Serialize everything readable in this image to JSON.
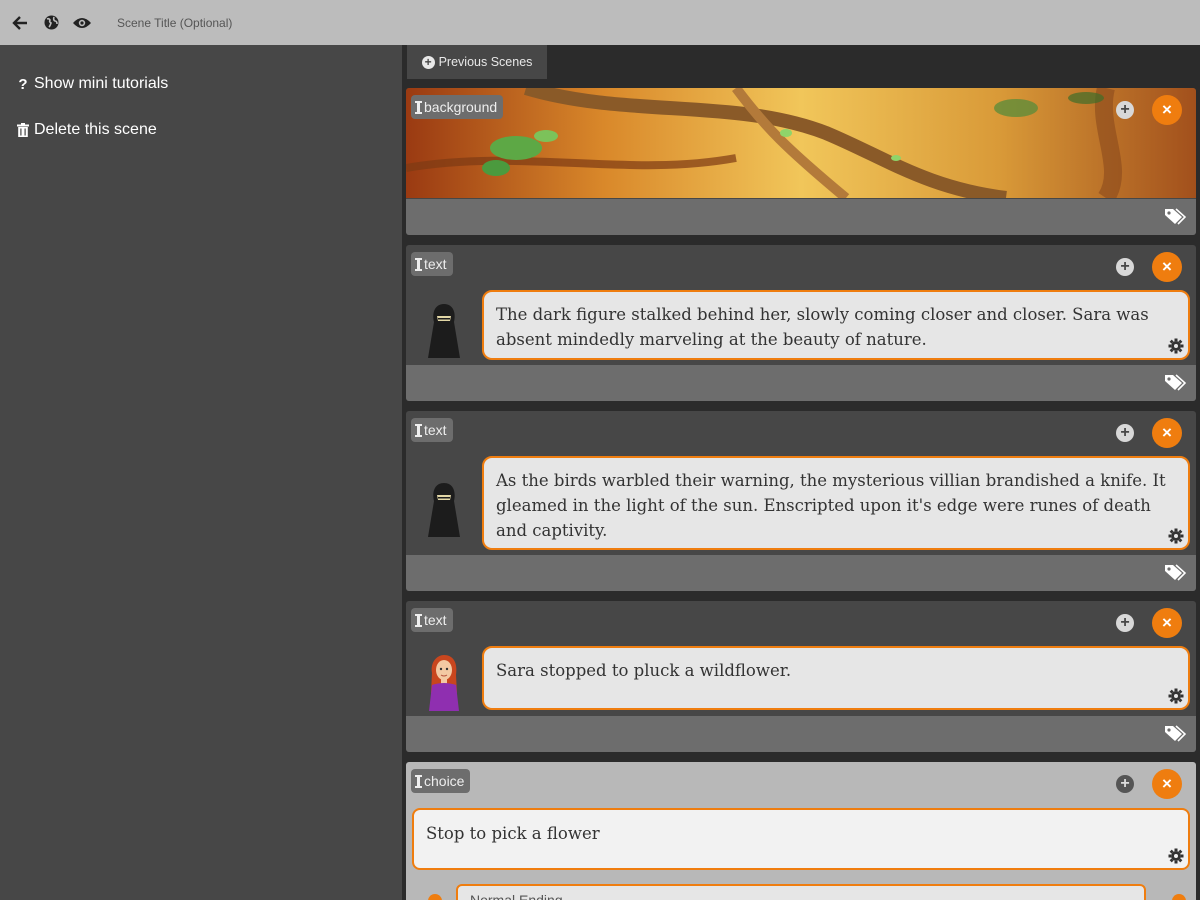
{
  "topbar": {
    "back_icon": "arrow-left-icon",
    "globe_icon": "globe-icon",
    "preview_icon": "eye-icon",
    "title_placeholder": "Scene Title (Optional)"
  },
  "sidebar": {
    "items": [
      {
        "icon": "question-icon",
        "icon_glyph": "?",
        "label": "Show mini tutorials"
      },
      {
        "icon": "trash-icon",
        "label": "Delete this scene"
      }
    ]
  },
  "main": {
    "previous_tab": {
      "icon": "plus-circle-icon",
      "label": "Previous Scenes"
    },
    "cards": [
      {
        "type": "background"
      },
      {
        "type": "text",
        "character": "dark-figure",
        "text": "The dark figure stalked behind her, slowly coming closer and closer. Sara was absent mindedly marveling at the beauty of nature."
      },
      {
        "type": "text",
        "character": "dark-figure",
        "text": "As the birds warbled their warning, the mysterious villian brandished a knife. It gleamed in the light of the sun. Enscripted upon it's edge were runes of death and captivity."
      },
      {
        "type": "text",
        "character": "sara",
        "text": "Sara stopped to pluck a wildflower."
      },
      {
        "type": "choice",
        "text": "Stop to pick a flower",
        "ending": "Normal Ending"
      }
    ],
    "add_glyph": "+",
    "close_glyph": "×"
  },
  "colors": {
    "accent": "#ef7d0f",
    "topbar": "#bcbcbc",
    "sidebar": "#474747",
    "main_bg": "#2b2b2b",
    "card_footer": "#6d6d6d"
  }
}
